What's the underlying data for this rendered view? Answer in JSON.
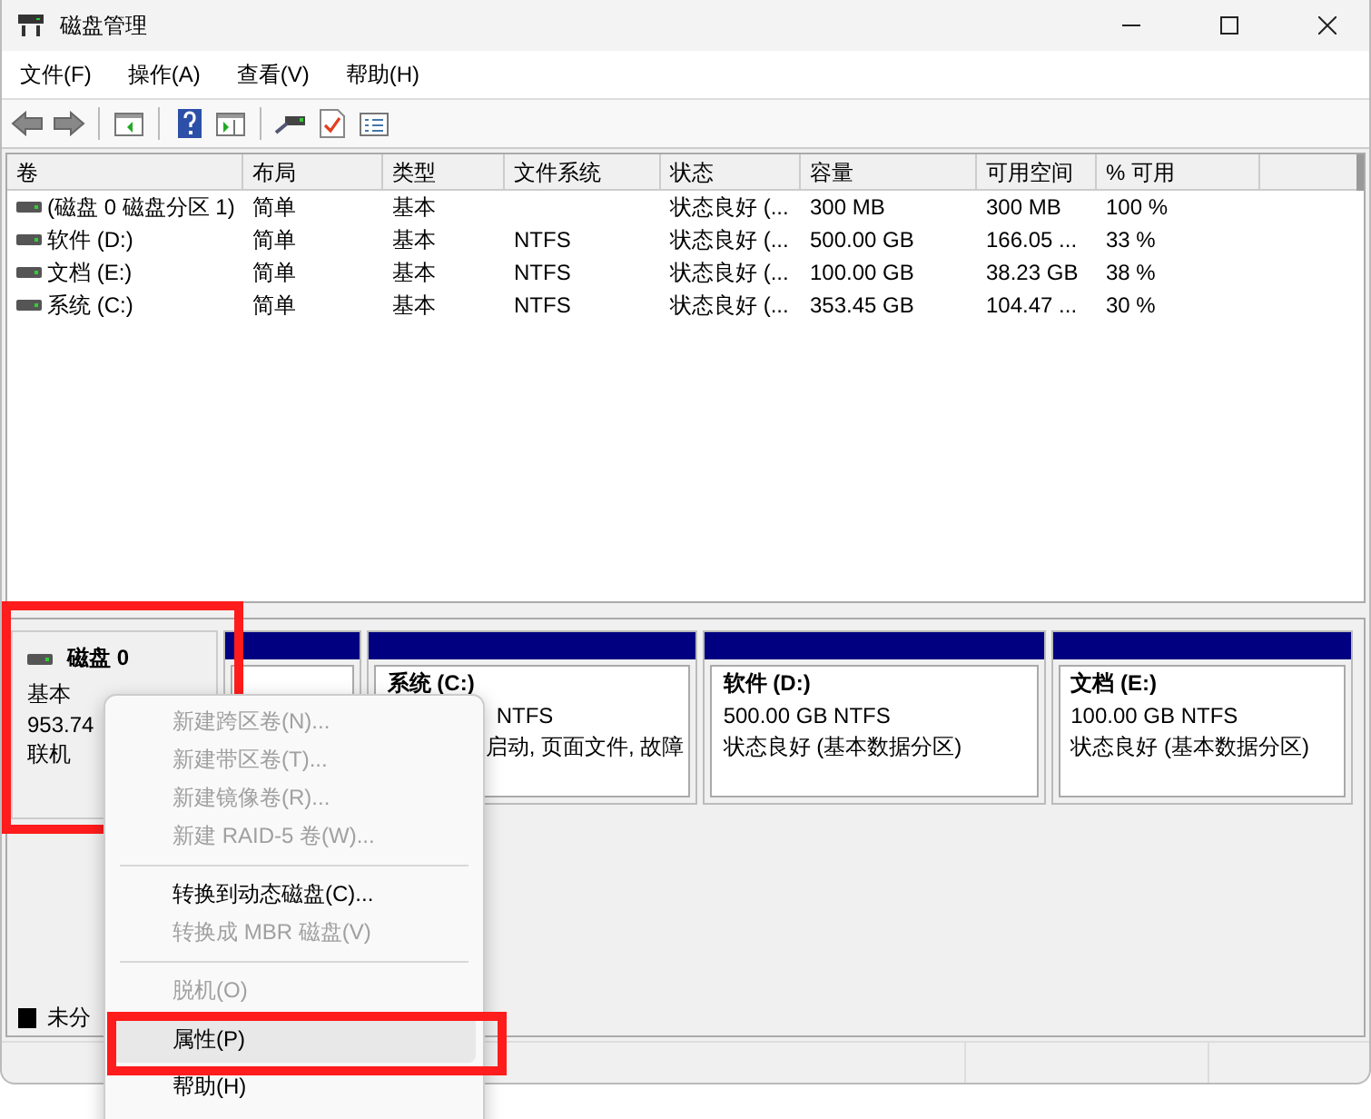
{
  "window": {
    "title": "磁盘管理"
  },
  "menu_bar": [
    {
      "label": "文件(F)"
    },
    {
      "label": "操作(A)"
    },
    {
      "label": "查看(V)"
    },
    {
      "label": "帮助(H)"
    }
  ],
  "volume_table": {
    "columns": [
      "卷",
      "布局",
      "类型",
      "文件系统",
      "状态",
      "容量",
      "可用空间",
      "% 可用"
    ],
    "rows": [
      {
        "cells": [
          "(磁盘 0 磁盘分区 1)",
          "简单",
          "基本",
          "",
          "状态良好 (...",
          "300 MB",
          "300 MB",
          "100 %"
        ]
      },
      {
        "cells": [
          "软件 (D:)",
          "简单",
          "基本",
          "NTFS",
          "状态良好 (...",
          "500.00 GB",
          "166.05 ...",
          "33 %"
        ]
      },
      {
        "cells": [
          "文档 (E:)",
          "简单",
          "基本",
          "NTFS",
          "状态良好 (...",
          "100.00 GB",
          "38.23 GB",
          "38 %"
        ]
      },
      {
        "cells": [
          "系统 (C:)",
          "简单",
          "基本",
          "NTFS",
          "状态良好 (...",
          "353.45 GB",
          "104.47 ...",
          "30 %"
        ]
      }
    ]
  },
  "disk_map": {
    "disk": {
      "name": "磁盘 0",
      "type": "基本",
      "size": "953.74",
      "status": "联机"
    },
    "partitions": [
      {
        "kind": "primary"
      },
      {
        "kind": "primary",
        "title": "系统 (C:)",
        "lines": [
          "NTFS",
          "启动, 页面文件, 故障"
        ]
      },
      {
        "kind": "primary",
        "title": "软件 (D:)",
        "lines": [
          "500.00 GB NTFS",
          "状态良好 (基本数据分区)"
        ]
      },
      {
        "kind": "primary",
        "title": "文档 (E:)",
        "lines": [
          "100.00 GB NTFS",
          "状态良好 (基本数据分区)"
        ]
      }
    ]
  },
  "legend": [
    {
      "label": "未分",
      "color": "#000000"
    }
  ],
  "context_menu": {
    "items": [
      {
        "kind": "item",
        "label": "新建跨区卷(N)...",
        "disabled": true,
        "selected": false
      },
      {
        "kind": "item",
        "label": "新建带区卷(T)...",
        "disabled": true,
        "selected": false
      },
      {
        "kind": "item",
        "label": "新建镜像卷(R)...",
        "disabled": true,
        "selected": false
      },
      {
        "kind": "item",
        "label": "新建 RAID-5 卷(W)...",
        "disabled": true,
        "selected": false
      },
      {
        "kind": "separator"
      },
      {
        "kind": "item",
        "label": "转换到动态磁盘(C)...",
        "disabled": false,
        "selected": false
      },
      {
        "kind": "item",
        "label": "转换成 MBR 磁盘(V)",
        "disabled": true,
        "selected": false
      },
      {
        "kind": "separator"
      },
      {
        "kind": "item",
        "label": "脱机(O)",
        "disabled": true,
        "selected": false
      },
      {
        "kind": "item",
        "label": "属性(P)",
        "disabled": false,
        "selected": true
      },
      {
        "kind": "item",
        "label": "帮助(H)",
        "disabled": false,
        "selected": false
      }
    ]
  }
}
